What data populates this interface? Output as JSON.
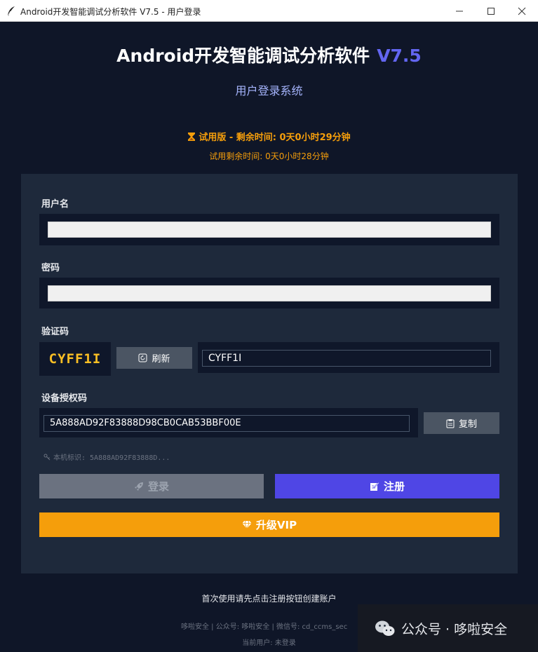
{
  "window": {
    "title": "Android开发智能调试分析软件 V7.5 - 用户登录",
    "controls": [
      "minimize-icon",
      "maximize-icon",
      "close-icon"
    ]
  },
  "header": {
    "app_name": "Android开发智能调试分析软件",
    "version": "V7.5",
    "subtitle": "用户登录系统"
  },
  "trial": {
    "status": "试用版 - 剩余时间: 0天0小时29分钟",
    "remaining": "试用剩余时间: 0天0小时28分钟"
  },
  "form": {
    "username_label": "用户名",
    "username_value": "",
    "password_label": "密码",
    "password_value": "",
    "captcha_label": "验证码",
    "captcha_code": "CYFF1I",
    "captcha_input_value": "CYFF1I",
    "refresh_label": "刷新",
    "device_code_label": "设备授权码",
    "device_code_value": "5A888AD92F83888D98CB0CAB53BBF00E",
    "copy_label": "复制",
    "machine_id": "本机标识: 5A888AD92F83888D..."
  },
  "actions": {
    "login_label": "登录",
    "register_label": "注册",
    "vip_label": "升级VIP"
  },
  "footer": {
    "hint": "首次使用请先点击注册按钮创建账户",
    "info": "哆啦安全 | 公众号: 哆啦安全 | 微信号: cd_ccms_sec",
    "current_user": "当前用户: 未登录"
  },
  "watermark": {
    "text": "公众号 · 哆啦安全"
  },
  "colors": {
    "background": "#0f1628",
    "panel": "#1e293b",
    "accent": "#6366f1",
    "register": "#4f46e5",
    "vip": "#f59e0b",
    "captcha": "#fbbf24"
  }
}
